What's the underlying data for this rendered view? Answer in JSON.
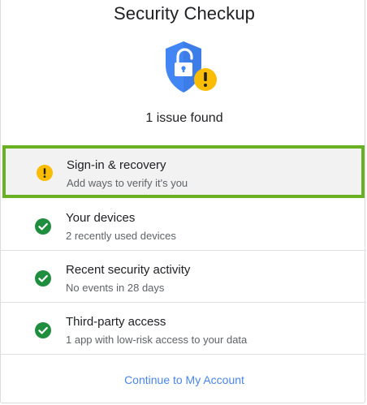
{
  "header": {
    "title": "Security Checkup",
    "hero_icon": "shield-unlocked-warning-icon",
    "summary": "1 issue found"
  },
  "items": [
    {
      "label": "Sign-in & recovery",
      "sub": "Add ways to verify it's you",
      "status": "warning",
      "status_icon": "warning-icon",
      "highlighted": true
    },
    {
      "label": "Your devices",
      "sub": "2 recently used devices",
      "status": "ok",
      "status_icon": "check-circle-icon"
    },
    {
      "label": "Recent security activity",
      "sub": "No events in 28 days",
      "status": "ok",
      "status_icon": "check-circle-icon"
    },
    {
      "label": "Third-party access",
      "sub": "1 app with low-risk access to your data",
      "status": "ok",
      "status_icon": "check-circle-icon"
    }
  ],
  "footer": {
    "continue_label": "Continue to My Account"
  },
  "colors": {
    "shield_blue": "#4285f4",
    "warning_yellow": "#fbbc04",
    "ok_green": "#1e8e3e",
    "highlight_border": "#6ab023",
    "link_blue": "#4a86e8"
  }
}
